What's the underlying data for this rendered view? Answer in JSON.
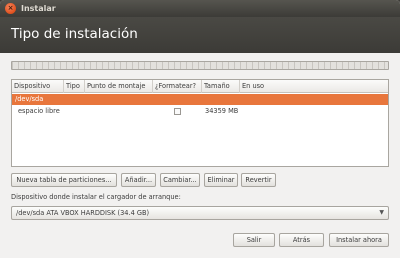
{
  "window": {
    "title": "Instalar",
    "close_symbol": "×"
  },
  "page": {
    "title": "Tipo de instalación"
  },
  "table": {
    "headers": [
      "Dispositivo",
      "Tipo",
      "Punto de montaje",
      "¿Formatear?",
      "Tamaño",
      "En uso"
    ],
    "rows": [
      {
        "device": "/dev/sda",
        "type": "",
        "mount": "",
        "format": "",
        "size": "",
        "used": "",
        "selected": true
      },
      {
        "device": "espacio libre",
        "type": "",
        "mount": "",
        "format": "checkbox",
        "size": "34359 MB",
        "used": "",
        "selected": false
      }
    ]
  },
  "partition_buttons": {
    "new_table": "Nueva tabla de particiones...",
    "add": "Añadir...",
    "change": "Cambiar...",
    "delete": "Eliminar",
    "revert": "Revertir"
  },
  "bootloader": {
    "label": "Dispositivo donde instalar el cargador de arranque:",
    "selected": "/dev/sda  ATA VBOX HARDDISK (34.4 GB)",
    "arrow": "▼"
  },
  "nav_buttons": {
    "quit": "Salir",
    "back": "Atrás",
    "install_now": "Instalar ahora"
  },
  "colors": {
    "selection": "#e8763c",
    "header": "#3c3b37",
    "close": "#e0501d"
  }
}
